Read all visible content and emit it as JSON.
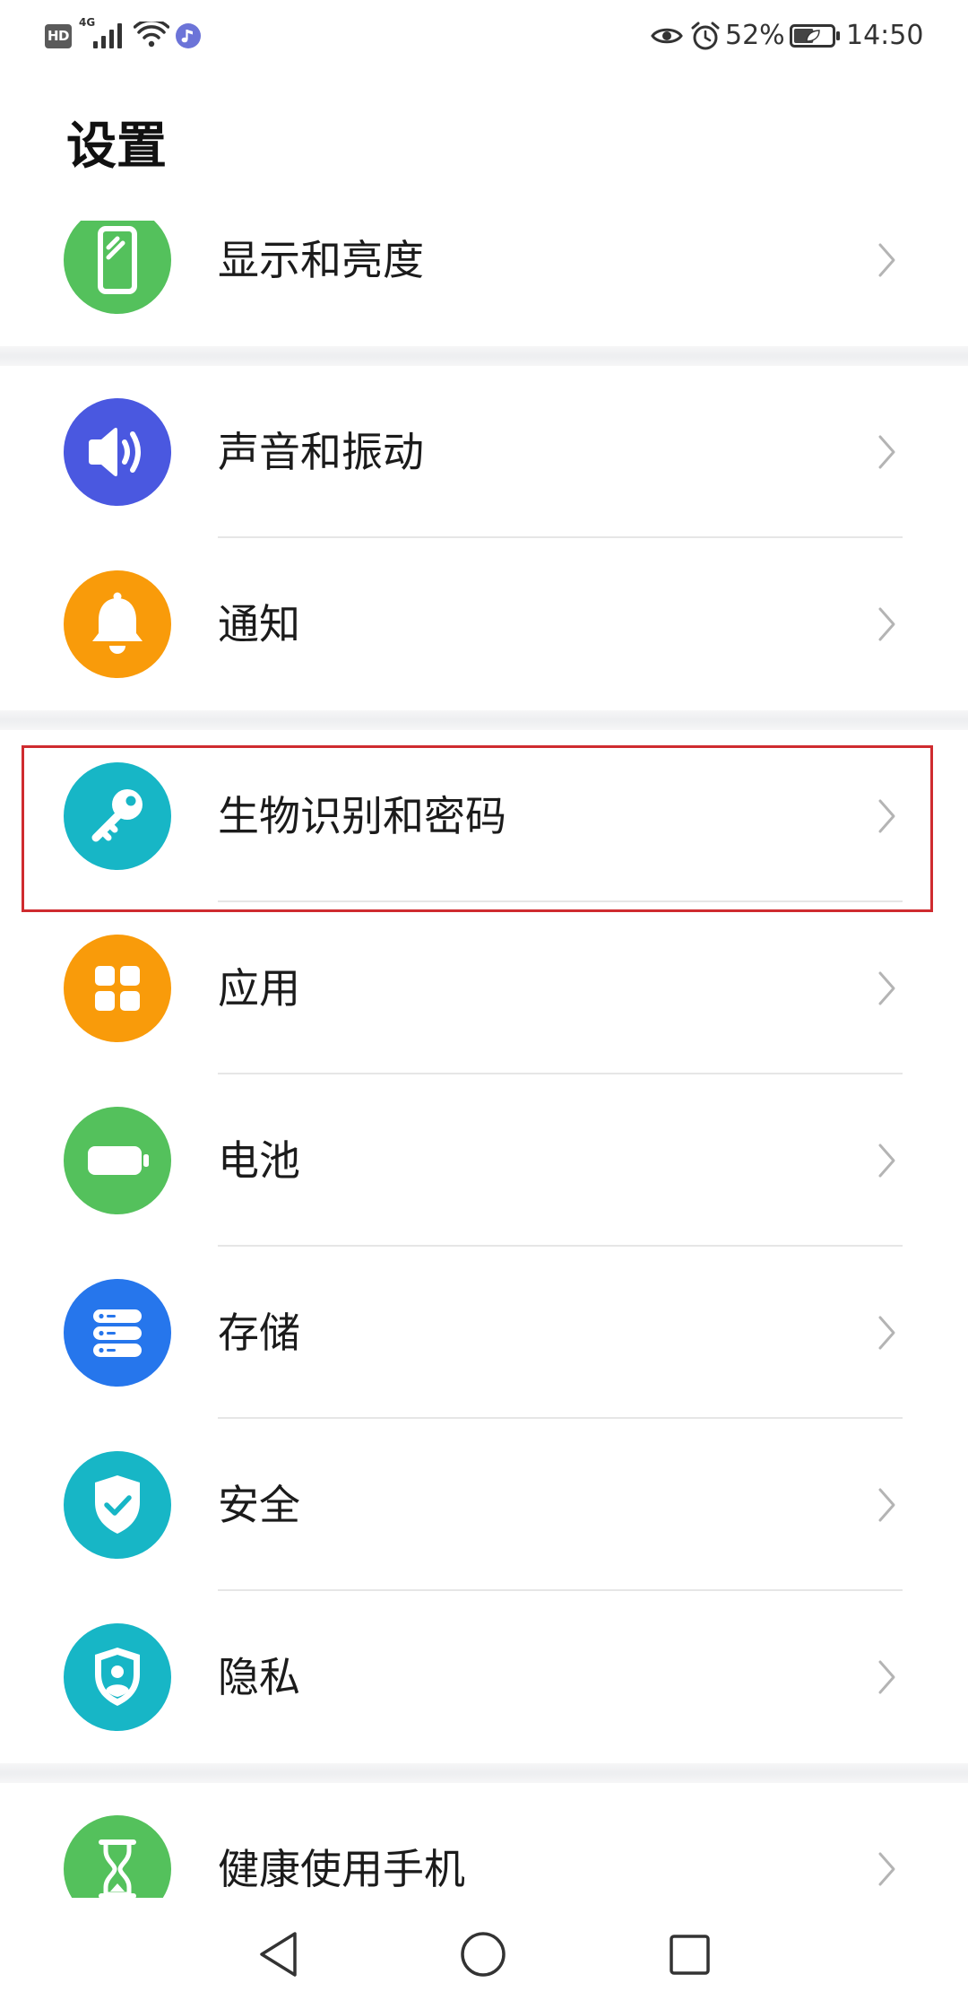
{
  "status_bar": {
    "hd_label": "HD",
    "network_label": "4G",
    "battery_text": "52%",
    "battery_level": 0.52,
    "time": "14:50",
    "icons": {
      "signal": "signal-icon",
      "wifi": "wifi-icon",
      "music": "music-notification-icon",
      "eye": "eye-comfort-icon",
      "alarm": "alarm-icon",
      "battery": "battery-saver-icon"
    }
  },
  "header": {
    "title": "设置"
  },
  "groups": [
    {
      "items": [
        {
          "label": "显示和亮度",
          "icon": "display-icon",
          "color": "#54c15c"
        }
      ]
    },
    {
      "items": [
        {
          "label": "声音和振动",
          "icon": "sound-icon",
          "color": "#4a58e0"
        },
        {
          "label": "通知",
          "icon": "bell-icon",
          "color": "#f99b0a"
        }
      ]
    },
    {
      "items": [
        {
          "label": "生物识别和密码",
          "icon": "key-icon",
          "color": "#17b6c6",
          "highlighted": true
        },
        {
          "label": "应用",
          "icon": "apps-grid-icon",
          "color": "#f99b0a"
        },
        {
          "label": "电池",
          "icon": "battery-icon",
          "color": "#54c15c"
        },
        {
          "label": "存储",
          "icon": "storage-icon",
          "color": "#2676ec"
        },
        {
          "label": "安全",
          "icon": "shield-check-icon",
          "color": "#17b6c6"
        },
        {
          "label": "隐私",
          "icon": "privacy-shield-icon",
          "color": "#17b6c6"
        }
      ]
    },
    {
      "items": [
        {
          "label": "健康使用手机",
          "icon": "hourglass-icon",
          "color": "#54c15c"
        }
      ]
    }
  ],
  "row_chevron_icon": "chevron-right-icon",
  "highlight": {
    "color": "#cf2b2f"
  },
  "nav_bar": {
    "icons": [
      "back-icon",
      "home-icon",
      "recents-icon"
    ]
  },
  "colors": {
    "text": "#1b1b1b",
    "chevron": "#b4b4b4",
    "group_separator": "#eeeff1",
    "divider": "#e6e6e6",
    "music_badge": "#6c74d8"
  }
}
